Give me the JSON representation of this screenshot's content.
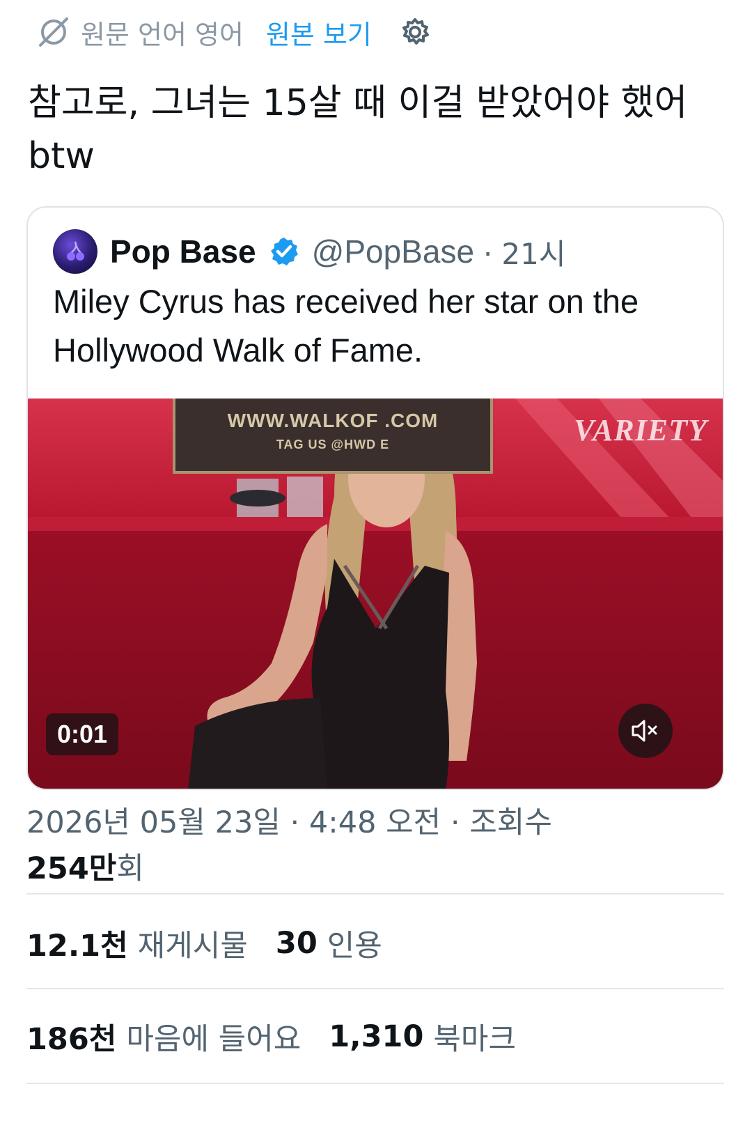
{
  "translation_bar": {
    "icon": "translate-icon",
    "source_language_text": "원문 언어 영어",
    "show_original_label": "원본 보기",
    "settings_icon": "gear-icon",
    "link_color": "#1d9bf0"
  },
  "post": {
    "text": "참고로, 그녀는 15살 때 이걸 받았어야 했어 btw"
  },
  "quoted_post": {
    "author_name": "Pop Base",
    "verified_icon": "verified-badge-icon",
    "handle": "@PopBase",
    "separator": "·",
    "time": "21시",
    "text": "Miley Cyrus has received her star on the Hollywood Walk of Fame.",
    "video": {
      "plaque_line1": "WWW.WALKOF      .COM",
      "plaque_line2": "TAG US @HWD           E",
      "watermark": "VARIETY",
      "elapsed": "0:01",
      "mute_icon": "speaker-muted-icon"
    }
  },
  "meta": {
    "timestamp": "2026년 05월 23일 · 4:48 오전 · 조회수",
    "views_number": "254만",
    "views_suffix": "회"
  },
  "stats": {
    "reposts_count": "12.1천",
    "reposts_label": "재게시물",
    "quotes_count": "30",
    "quotes_label": "인용",
    "likes_count": "186천",
    "likes_label": "마음에 들어요",
    "bookmarks_count": "1,310",
    "bookmarks_label": "북마크"
  },
  "colors": {
    "text_primary": "#0f1419",
    "text_secondary": "#536471",
    "accent": "#1d9bf0",
    "carpet": "#a5102a"
  }
}
